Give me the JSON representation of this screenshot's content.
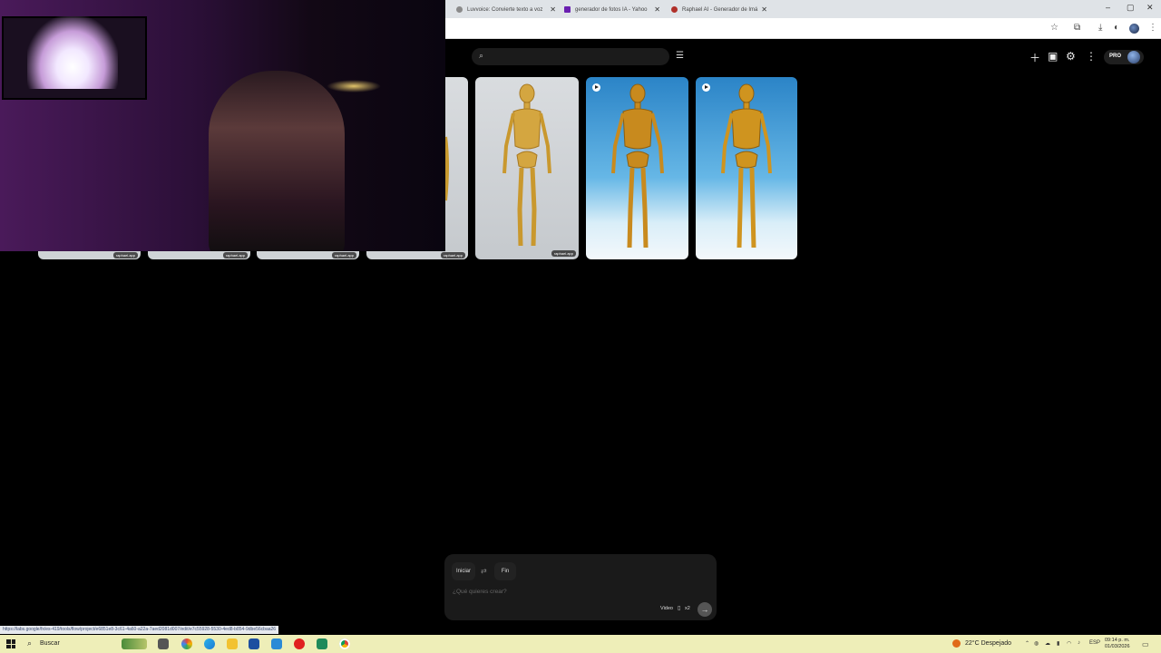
{
  "browser": {
    "tabs": [
      {
        "label": "Luvvoice: Convierte texto a voz",
        "favicon_color": "#8a8a8a"
      },
      {
        "label": "generador de fotos IA - Yahoo",
        "favicon_color": "#6a1fb0"
      },
      {
        "label": "Raphael AI - Generador de Imá",
        "favicon_color": "#b0302a"
      }
    ],
    "new_tab": "+",
    "window_controls": [
      "–",
      "▢",
      "✕"
    ]
  },
  "toolbar_icons": [
    "star-icon",
    "extensions-icon",
    "download-icon",
    "profile-icon",
    "menu-icon"
  ],
  "app": {
    "search_placeholder": "",
    "pro_label": "PRO"
  },
  "gallery": {
    "thumbnails": [
      {
        "kind": "partial",
        "watermark": "",
        "video": false
      },
      {
        "kind": "gray",
        "watermark": "raphael.app",
        "video": false
      },
      {
        "kind": "blue",
        "watermark": "",
        "video": true
      },
      {
        "kind": "blue",
        "watermark": "",
        "video": true
      }
    ],
    "strip_watermarks": [
      "raphael.app",
      "raphael.app",
      "raphael.app",
      "raphael.app"
    ]
  },
  "composer": {
    "start_label": "Iniciar",
    "end_label": "Fin",
    "prompt_placeholder": "¿Qué quieres crear?",
    "mode_label": "Video",
    "count_label": "x2",
    "send_icon": "→"
  },
  "status_url": "https://labs.google/fx/es-419/tools/flow/project/e6851e8-3c61-4a60-a22a-7aed2081d007/edit/e7c55928-5530-4ed8-b854-9dbe56cbaa26",
  "taskbar": {
    "search_label": "Buscar",
    "weather": "22°C  Despejado",
    "language": "ESP",
    "time": "09:14 p. m.",
    "date": "01/03/2026"
  }
}
